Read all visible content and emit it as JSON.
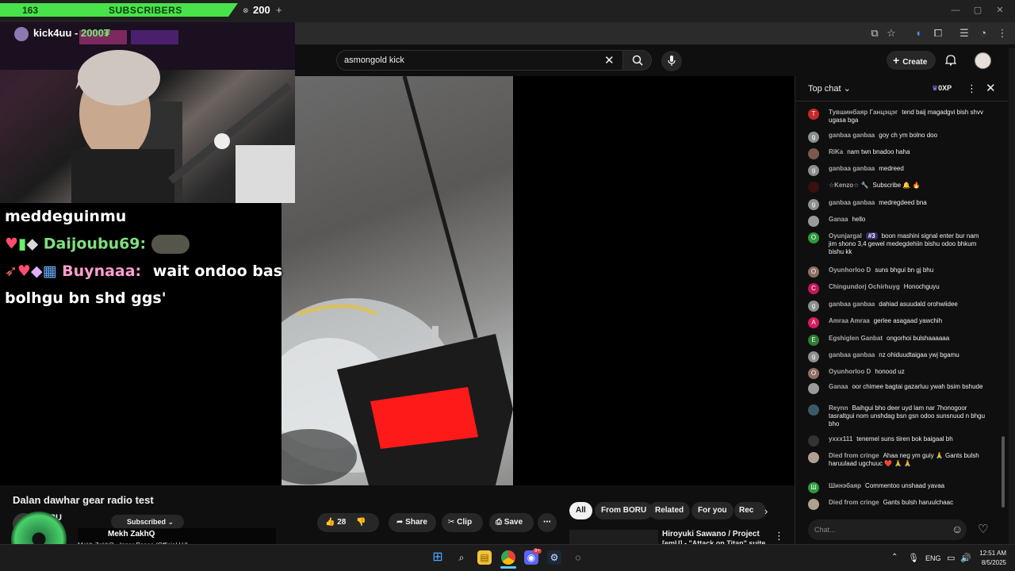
{
  "overlay": {
    "sub_count": "163",
    "sub_label": "SUBSCRIBERS",
    "goal": "200",
    "kick_user": "kick4uu - ",
    "kick_amount": "2000₮",
    "chat1_text": "meddeguinmu",
    "chat2_name": "Daijoubu69:",
    "chat3_name": "Buynaaa:",
    "chat3_text": "wait ondoo bas",
    "chat3_text2": "bolhgu bn shd ggs'"
  },
  "search": {
    "query": "asmongold kick"
  },
  "header": {
    "create_label": "Create"
  },
  "video": {
    "title": "Dalan dawhar gear radio test",
    "channel_short": "RU",
    "subscribed_label": "Subscribed",
    "like_count": "28",
    "share_label": "Share",
    "clip_label": "Clip",
    "save_label": "Save"
  },
  "music_popup": {
    "artist": "Mekh ZakhQ",
    "track": "Mekh ZakhQ - Inner Peace (Official LV)"
  },
  "related": {
    "chips": [
      "All",
      "From BORU",
      "Related",
      "For you",
      "Rec"
    ],
    "item_title": "Hiroyuki Sawano / Project",
    "item_subtitle": "[emU] - \"Attack on Titan\" suite"
  },
  "chat": {
    "title": "Top chat",
    "xp": "0XP",
    "input_placeholder": "Chat...",
    "messages": [
      {
        "author": "Тувшинбаяр Ганцэцэг",
        "text": "tend baij magadgvi bish shvv ugasa bga",
        "initial": "T",
        "color": "#c62828"
      },
      {
        "author": "ganbaa ganbaa",
        "text": "goy ch ym bolno doo",
        "initial": "g",
        "color": "#8a8f8f"
      },
      {
        "author": "RiKa",
        "text": "nam twn bnadoo haha",
        "initial": "",
        "color": "#7a5a4a"
      },
      {
        "author": "ganbaa ganbaa",
        "text": "medreed",
        "initial": "g",
        "color": "#8a8f8f"
      },
      {
        "author": "☆Kenzo☆ 🔧",
        "text": "Subscribe 🔔 🔥",
        "initial": "",
        "color": "#3a1010"
      },
      {
        "author": "ganbaa ganbaa",
        "text": "medregdeed bna",
        "initial": "g",
        "color": "#8a8f8f"
      },
      {
        "author": "Ganaa",
        "text": "hello",
        "initial": "",
        "color": "#9a9a9a"
      },
      {
        "author": "Oyunjargal",
        "badge": "#3",
        "text": "boon mashini signal enter bur nam jim shono 3,4 gewel medegdehiin bishu odoo bhkum bishu kk",
        "initial": "O",
        "color": "#2e9b3a"
      },
      {
        "author": "Oyunhorloo D",
        "text": "suns bhgui bn gj bhu",
        "initial": "O",
        "color": "#8d6e63"
      },
      {
        "author": "Chingundorj Ochirhuyg",
        "text": "Honochguyu",
        "initial": "C",
        "color": "#c2185b"
      },
      {
        "author": "ganbaa ganbaa",
        "text": "dahiad asuudald orohwiidee",
        "initial": "g",
        "color": "#8a8f8f"
      },
      {
        "author": "Amraa Amraa",
        "text": "gerlee asagaad yawchih",
        "initial": "A",
        "color": "#d81b60"
      },
      {
        "author": "Egshiglen Ganbat",
        "text": "ongorhoi bulshaaaaaa",
        "initial": "E",
        "color": "#2e7d32"
      },
      {
        "author": "ganbaa ganbaa",
        "text": "nz ohiduudtaigaa ywj bgamu",
        "initial": "g",
        "color": "#8a8f8f"
      },
      {
        "author": "Oyunhorloo D",
        "text": "honood uz",
        "initial": "O",
        "color": "#8d6e63"
      },
      {
        "author": "Ganaa",
        "text": "oor chimee bagtai gazarluu ywah bsim bshude",
        "initial": "",
        "color": "#9a9a9a"
      },
      {
        "author": "Reynn",
        "text": "Baihgui bho deer uyd lam nar 7honogoor tasraltgui nom unshdag bsn gsn odoo sunsnuud n bhgu bho",
        "initial": "",
        "color": "#3a5a6a"
      },
      {
        "author": "yxxx111",
        "text": "tenemel suns tiiren bok baigaal bh",
        "initial": "",
        "color": "#333333"
      },
      {
        "author": "Died from cringe",
        "text": "Ahaa neg ym guiy 🙏 Gants bulsh haruulaad ugchuuc ❤️ 🙏 🙏",
        "initial": "",
        "color": "#b0a090"
      },
      {
        "author": "Шинэбаяр",
        "text": "Commentoo unshaad yavaa",
        "initial": "Ш",
        "color": "#2e9b3a"
      },
      {
        "author": "Died from cringe",
        "text": "Gants bulsh haruulchaac",
        "initial": "",
        "color": "#b0a090"
      }
    ]
  },
  "taskbar": {
    "lang": "ENG",
    "time": "12:51 AM",
    "date": "8/5/2025",
    "discord_badge": "9+"
  }
}
